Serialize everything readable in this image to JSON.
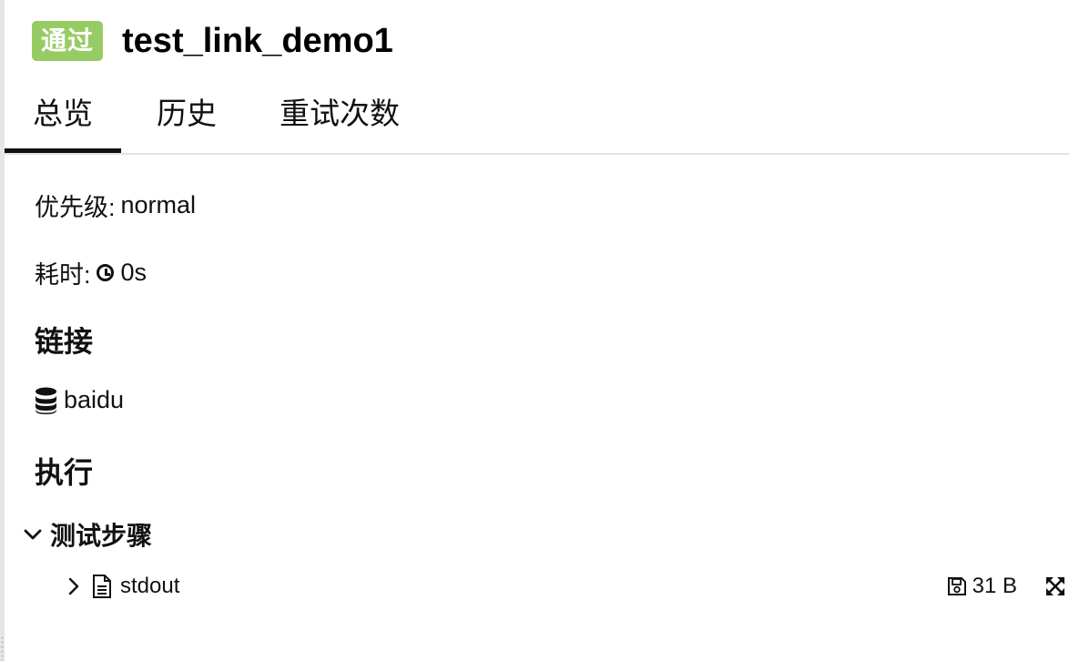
{
  "header": {
    "status": "通过",
    "title": "test_link_demo1"
  },
  "tabs": [
    {
      "label": "总览",
      "active": true
    },
    {
      "label": "历史",
      "active": false
    },
    {
      "label": "重试次数",
      "active": false
    }
  ],
  "overview": {
    "priority_label": "优先级:",
    "priority_value": "normal",
    "duration_label": "耗时:",
    "duration_value": "0s",
    "duration_icon": "clock-icon"
  },
  "links": {
    "title": "链接",
    "items": [
      {
        "icon": "database-icon",
        "label": "baidu"
      }
    ]
  },
  "execution": {
    "title": "执行",
    "steps_title": "测试步骤",
    "attachments": [
      {
        "icon": "file-text-icon",
        "name": "stdout",
        "size": "31 B"
      }
    ]
  },
  "colors": {
    "status_passed": "#97cc64",
    "text": "#111111",
    "divider": "#e2e2e2"
  }
}
